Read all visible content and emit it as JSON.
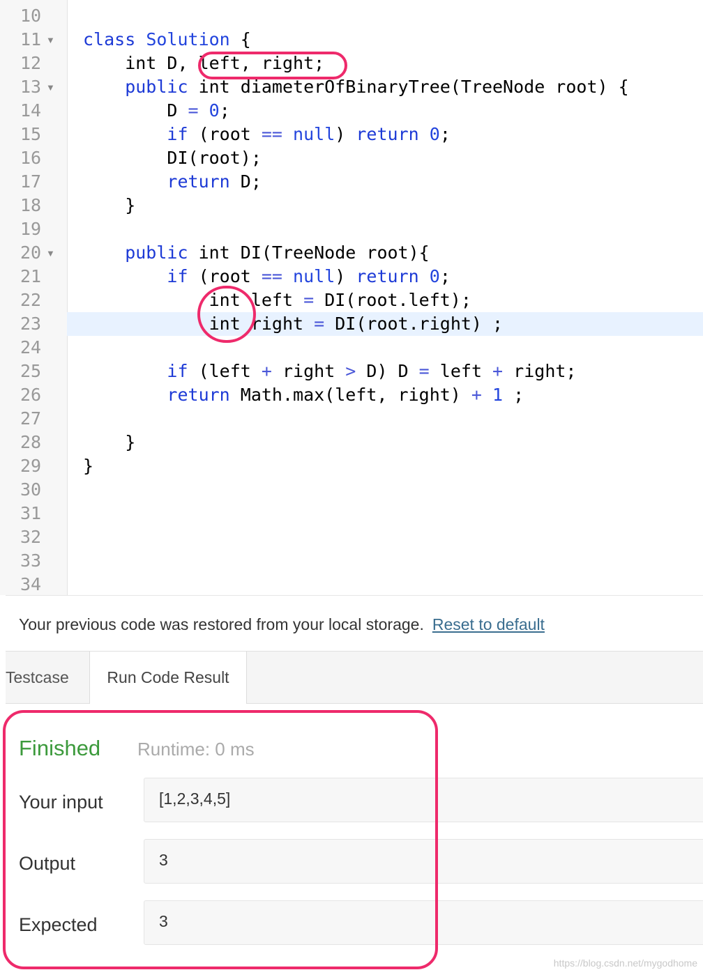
{
  "editor": {
    "lines": [
      {
        "n": "10",
        "fold": false,
        "tokens": []
      },
      {
        "n": "11",
        "fold": true,
        "tokens": [
          [
            "kw",
            "class "
          ],
          [
            "nm",
            "Solution"
          ],
          [
            "p",
            " {"
          ]
        ]
      },
      {
        "n": "12",
        "fold": false,
        "tokens": [
          [
            "p",
            "    int D, left, right;"
          ]
        ]
      },
      {
        "n": "13",
        "fold": true,
        "tokens": [
          [
            "kw",
            "    public"
          ],
          [
            "p",
            " int diameterOfBinaryTree(TreeNode root) {"
          ]
        ]
      },
      {
        "n": "14",
        "fold": false,
        "tokens": [
          [
            "p",
            "        D "
          ],
          [
            "op",
            "="
          ],
          [
            "p",
            " "
          ],
          [
            "nm",
            "0"
          ],
          [
            "p",
            ";"
          ]
        ]
      },
      {
        "n": "15",
        "fold": false,
        "tokens": [
          [
            "kw",
            "        if"
          ],
          [
            "p",
            " (root "
          ],
          [
            "op",
            "=="
          ],
          [
            "p",
            " "
          ],
          [
            "nm",
            "null"
          ],
          [
            "p",
            ") "
          ],
          [
            "kw",
            "return"
          ],
          [
            "p",
            " "
          ],
          [
            "nm",
            "0"
          ],
          [
            "p",
            ";"
          ]
        ]
      },
      {
        "n": "16",
        "fold": false,
        "tokens": [
          [
            "p",
            "        DI(root);"
          ]
        ]
      },
      {
        "n": "17",
        "fold": false,
        "tokens": [
          [
            "kw",
            "        return"
          ],
          [
            "p",
            " D;"
          ]
        ]
      },
      {
        "n": "18",
        "fold": false,
        "tokens": [
          [
            "p",
            "    }"
          ]
        ]
      },
      {
        "n": "19",
        "fold": false,
        "tokens": []
      },
      {
        "n": "20",
        "fold": true,
        "tokens": [
          [
            "kw",
            "    public"
          ],
          [
            "p",
            " int DI(TreeNode root){"
          ]
        ]
      },
      {
        "n": "21",
        "fold": false,
        "tokens": [
          [
            "kw",
            "        if"
          ],
          [
            "p",
            " (root "
          ],
          [
            "op",
            "=="
          ],
          [
            "p",
            " "
          ],
          [
            "nm",
            "null"
          ],
          [
            "p",
            ") "
          ],
          [
            "kw",
            "return"
          ],
          [
            "p",
            " "
          ],
          [
            "nm",
            "0"
          ],
          [
            "p",
            ";"
          ]
        ]
      },
      {
        "n": "22",
        "fold": false,
        "tokens": [
          [
            "p",
            "            int left "
          ],
          [
            "op",
            "="
          ],
          [
            "p",
            " DI(root.left);"
          ]
        ]
      },
      {
        "n": "23",
        "fold": false,
        "active": true,
        "tokens": [
          [
            "p",
            "            int right "
          ],
          [
            "op",
            "="
          ],
          [
            "p",
            " DI(root.right) ;"
          ]
        ]
      },
      {
        "n": "24",
        "fold": false,
        "tokens": []
      },
      {
        "n": "25",
        "fold": false,
        "tokens": [
          [
            "kw",
            "        if"
          ],
          [
            "p",
            " (left "
          ],
          [
            "op",
            "+"
          ],
          [
            "p",
            " right "
          ],
          [
            "op",
            ">"
          ],
          [
            "p",
            " D) D "
          ],
          [
            "op",
            "="
          ],
          [
            "p",
            " left "
          ],
          [
            "op",
            "+"
          ],
          [
            "p",
            " right;"
          ]
        ]
      },
      {
        "n": "26",
        "fold": false,
        "tokens": [
          [
            "kw",
            "        return"
          ],
          [
            "p",
            " Math.max(left, right) "
          ],
          [
            "op",
            "+"
          ],
          [
            "p",
            " "
          ],
          [
            "nm",
            "1"
          ],
          [
            "p",
            " ;"
          ]
        ]
      },
      {
        "n": "27",
        "fold": false,
        "tokens": []
      },
      {
        "n": "28",
        "fold": false,
        "tokens": [
          [
            "p",
            "    }"
          ]
        ]
      },
      {
        "n": "29",
        "fold": false,
        "tokens": [
          [
            "p",
            "}"
          ]
        ]
      },
      {
        "n": "30",
        "fold": false,
        "tokens": []
      },
      {
        "n": "31",
        "fold": false,
        "tokens": []
      },
      {
        "n": "32",
        "fold": false,
        "tokens": []
      },
      {
        "n": "33",
        "fold": false,
        "tokens": []
      },
      {
        "n": "34",
        "fold": false,
        "tokens": []
      }
    ]
  },
  "notice": {
    "text": "Your previous code was restored from your local storage.",
    "link": "Reset to default"
  },
  "tabs": {
    "testcase": "Testcase",
    "run_result": "Run Code Result"
  },
  "result": {
    "status": "Finished",
    "runtime": "Runtime: 0 ms",
    "input_label": "Your input",
    "input_value": "[1,2,3,4,5]",
    "output_label": "Output",
    "output_value": "3",
    "expected_label": "Expected",
    "expected_value": "3"
  },
  "watermark": "https://blog.csdn.net/mygodhome",
  "colors": {
    "keyword": "#1d3ad6",
    "finished": "#3c9a3c",
    "annotation": "#ee2a6b",
    "active_line": "#e8f2ff"
  }
}
